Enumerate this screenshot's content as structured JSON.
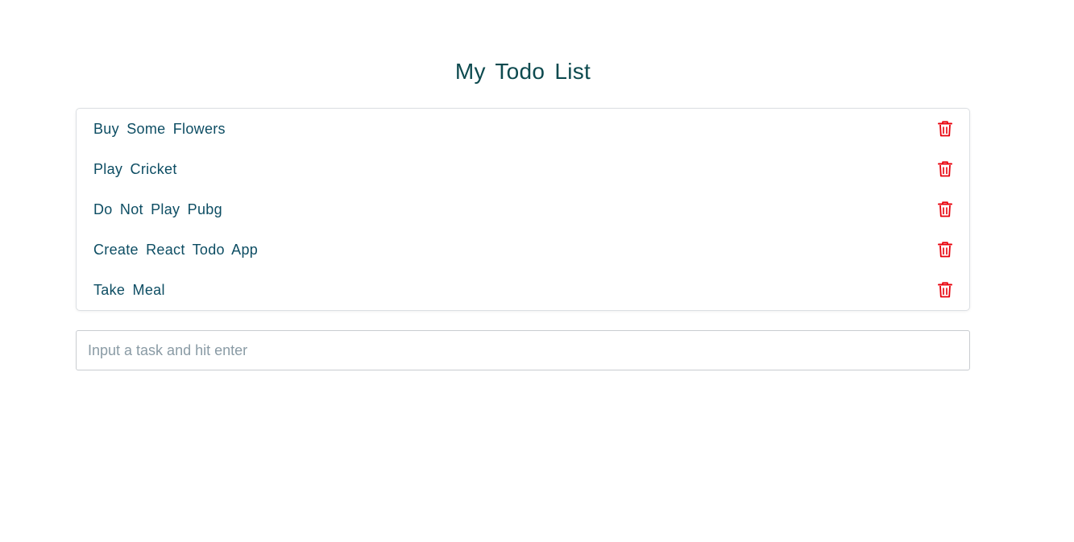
{
  "app": {
    "title": "My Todo List"
  },
  "todos": [
    {
      "text": "Buy Some Flowers",
      "action_icon": "trash-icon"
    },
    {
      "text": "Play Cricket",
      "action_icon": "trash-icon"
    },
    {
      "text": "Do Not Play Pubg",
      "action_icon": "trash-icon"
    },
    {
      "text": "Create React Todo App",
      "action_icon": "trash-icon"
    },
    {
      "text": "Take Meal",
      "action_icon": "trash-icon"
    }
  ],
  "input": {
    "placeholder": "Input a task and hit enter",
    "value": ""
  },
  "colors": {
    "title": "#0d4a4f",
    "todo_text": "#0d4d63",
    "delete_icon": "#e8000b",
    "border": "#dcdfe3",
    "placeholder": "#8a9ba5"
  }
}
